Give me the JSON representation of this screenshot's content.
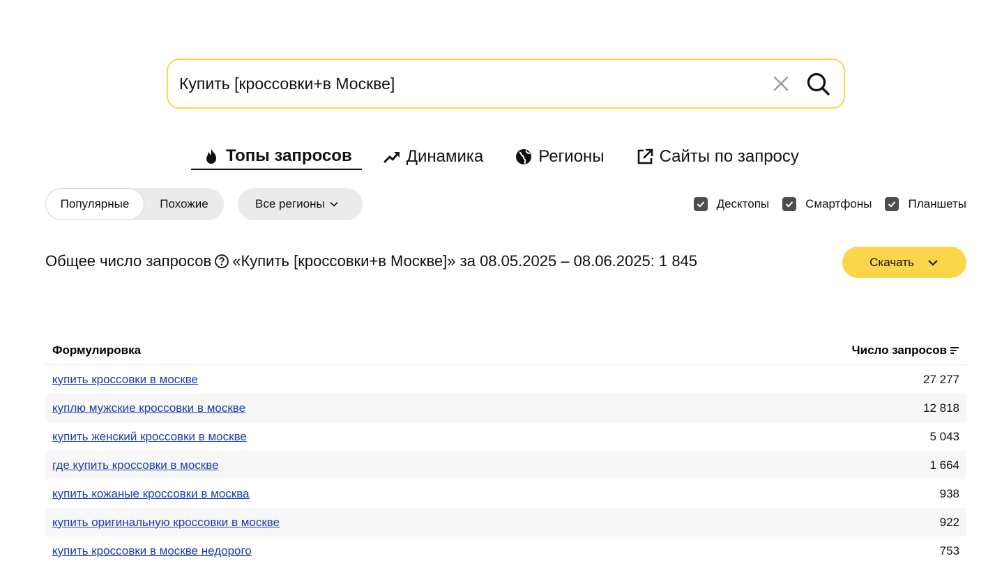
{
  "search": {
    "value": "Купить [кроссовки+в Москве]",
    "clear_icon": "close-icon",
    "submit_icon": "search-icon"
  },
  "tabs": [
    {
      "label": "Топы запросов",
      "icon": "fire-icon",
      "active": true
    },
    {
      "label": "Динамика",
      "icon": "trending-up-icon",
      "active": false
    },
    {
      "label": "Регионы",
      "icon": "globe-icon",
      "active": false
    },
    {
      "label": "Сайты по запросу",
      "icon": "external-link-icon",
      "active": false
    }
  ],
  "filters": {
    "popular": "Популярные",
    "similar": "Похожие",
    "region": "Все регионы",
    "devices": [
      {
        "label": "Десктопы",
        "checked": true
      },
      {
        "label": "Смартфоны",
        "checked": true
      },
      {
        "label": "Планшеты",
        "checked": true
      }
    ]
  },
  "summary": {
    "prefix": "Общее число запросов",
    "suffix": "«Купить [кроссовки+в Москве]» за 08.05.2025 – 08.06.2025: 1 845"
  },
  "download": {
    "label": "Скачать"
  },
  "table": {
    "col_phrase": "Формулировка",
    "col_count": "Число запросов",
    "rows": [
      {
        "phrase": "купить кроссовки в москве",
        "count": "27 277"
      },
      {
        "phrase": "куплю мужские кроссовки в москве",
        "count": "12 818"
      },
      {
        "phrase": "купить женский кроссовки в москве",
        "count": "5 043"
      },
      {
        "phrase": "где купить кроссовки в москве",
        "count": "1 664"
      },
      {
        "phrase": "купить кожаные кроссовки в москва",
        "count": "938"
      },
      {
        "phrase": "купить оригинальную кроссовки в москве",
        "count": "922"
      },
      {
        "phrase": "купить кроссовки в москве недорого",
        "count": "753"
      }
    ]
  },
  "colors": {
    "accent": "#fbd54a",
    "link": "#1a3dab",
    "checkbox": "#4d4d4d"
  }
}
